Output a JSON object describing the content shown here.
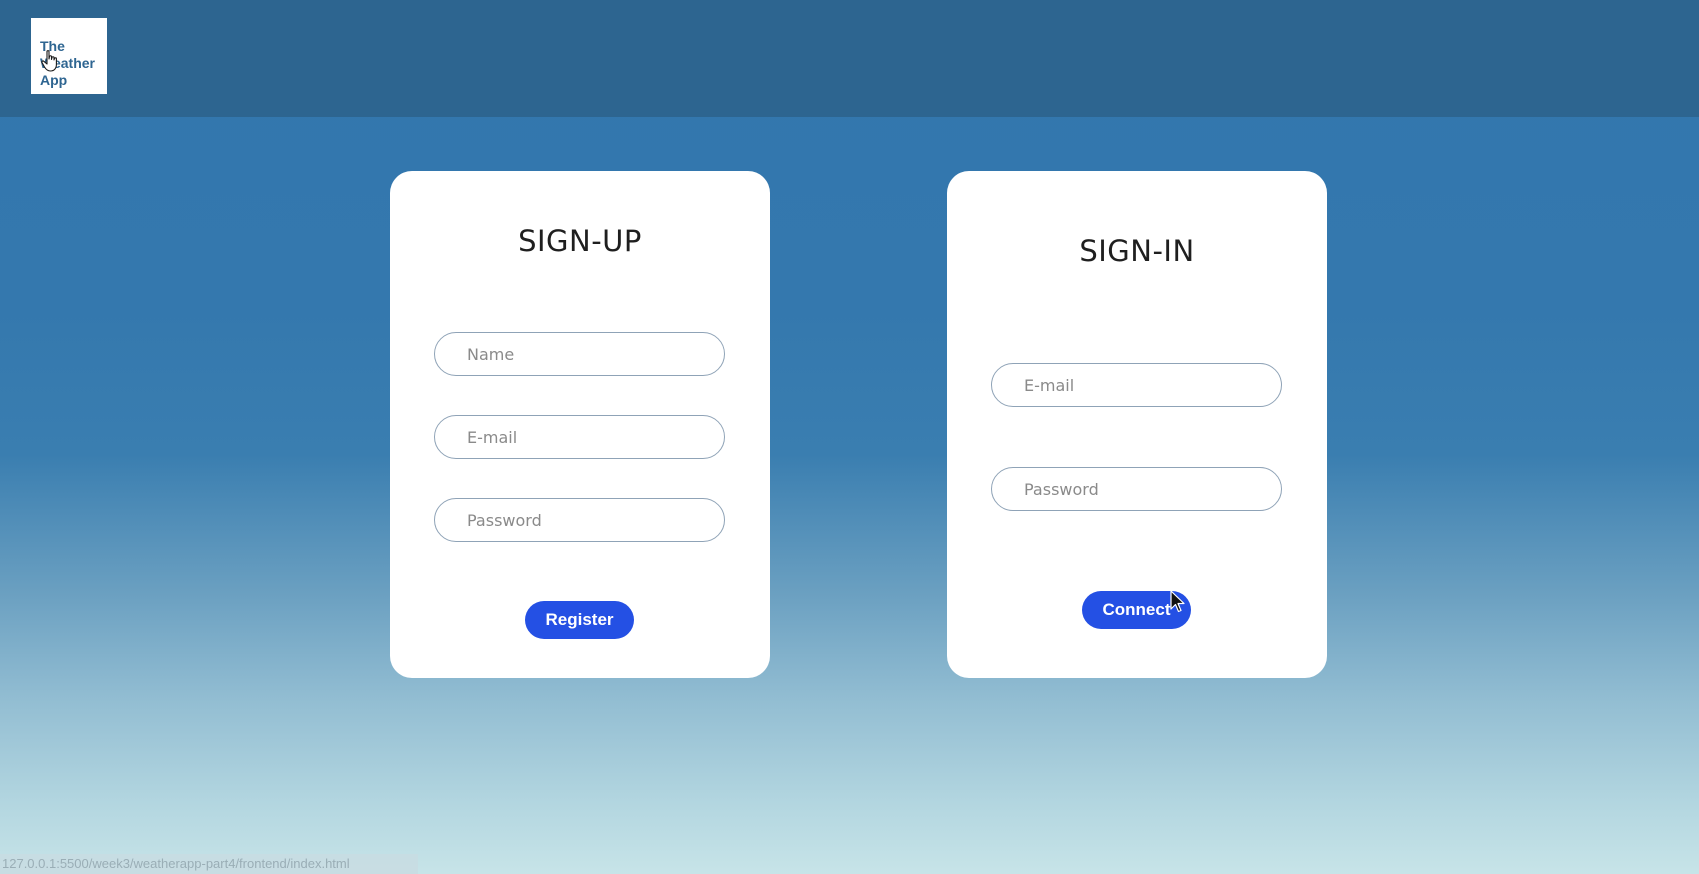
{
  "header": {
    "logo": {
      "lines": [
        "The",
        "Weather",
        "App"
      ],
      "color": "#2e6591"
    },
    "background": "#2d6590"
  },
  "signup": {
    "title": "SIGN-UP",
    "name_placeholder": "Name",
    "email_placeholder": "E-mail",
    "password_placeholder": "Password",
    "button_label": "Register"
  },
  "signin": {
    "title": "SIGN-IN",
    "email_placeholder": "E-mail",
    "password_placeholder": "Password",
    "button_label": "Connect"
  },
  "status_bar": {
    "url": "127.0.0.1:5500/week3/weatherapp-part4/frontend/index.html"
  },
  "colors": {
    "button": "#2450e4",
    "card": "#ffffff"
  },
  "icons": {
    "logo_cursor": "hand-pointer-icon",
    "mouse_cursor": "arrow-cursor-icon"
  }
}
